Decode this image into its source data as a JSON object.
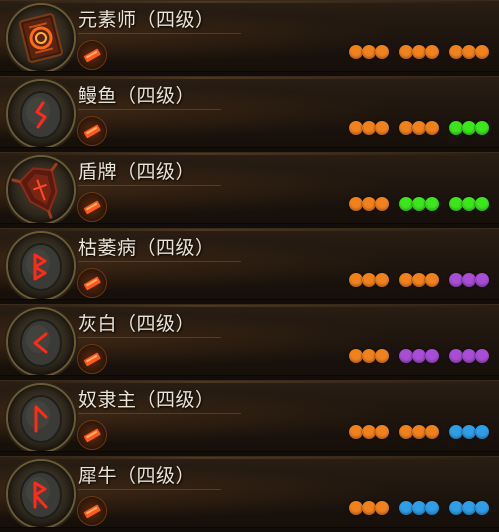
{
  "items": [
    {
      "name": "元素师（四级）",
      "icon": "fiery-tome-icon",
      "sockets": [
        "orange",
        "orange",
        "orange"
      ]
    },
    {
      "name": "鳗鱼（四级）",
      "icon": "rune-stone-icon",
      "sockets": [
        "orange",
        "orange",
        "green"
      ]
    },
    {
      "name": "盾牌（四级）",
      "icon": "spiked-shield-icon",
      "sockets": [
        "orange",
        "green",
        "green"
      ]
    },
    {
      "name": "枯萎病（四级）",
      "icon": "rune-stone-icon",
      "sockets": [
        "orange",
        "orange",
        "purple"
      ]
    },
    {
      "name": "灰白（四级）",
      "icon": "rune-stone-icon",
      "sockets": [
        "orange",
        "purple",
        "purple"
      ]
    },
    {
      "name": "奴隶主（四级）",
      "icon": "rune-stone-icon",
      "sockets": [
        "orange",
        "orange",
        "blue"
      ]
    },
    {
      "name": "犀牛（四级）",
      "icon": "rune-stone-icon",
      "sockets": [
        "orange",
        "blue",
        "blue"
      ]
    }
  ],
  "colors": {
    "orange": "#f0821e",
    "green": "#3de51c",
    "purple": "#a84ed6",
    "blue": "#2f9ee6",
    "rune_glow": "#ff2a1a"
  },
  "forge_button_icon": "forge-hammer-icon"
}
